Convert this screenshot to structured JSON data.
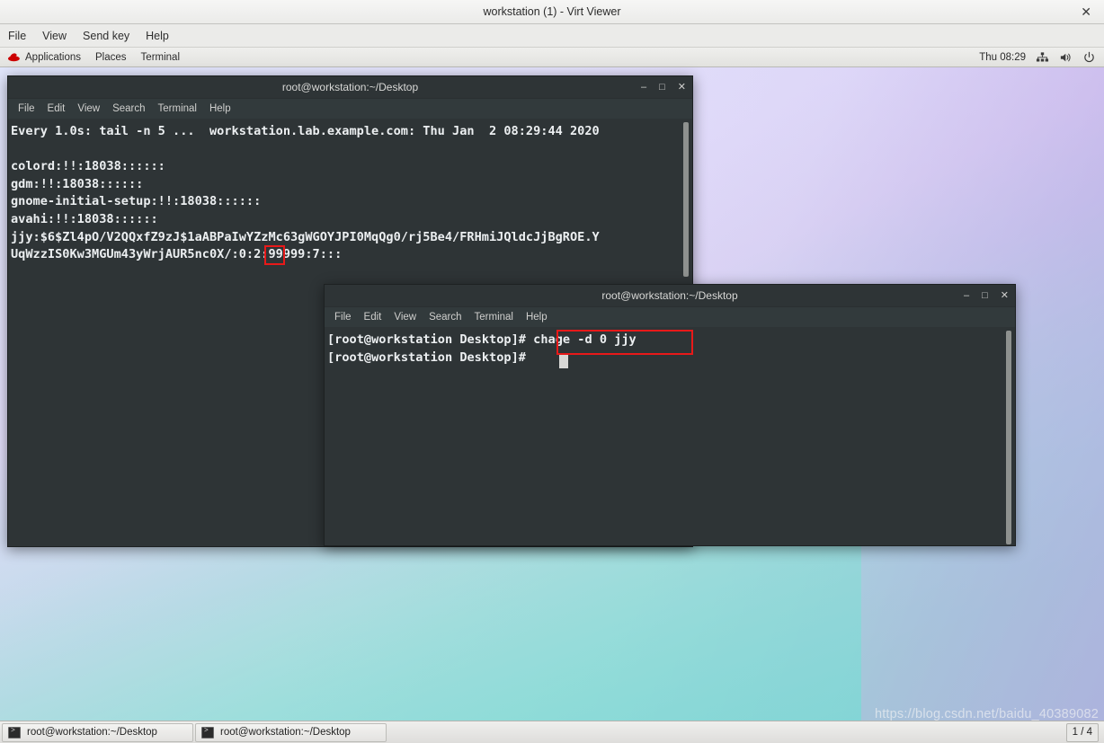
{
  "virt_viewer": {
    "title": "workstation (1) - Virt Viewer",
    "close_label": "✕",
    "menu": [
      "File",
      "View",
      "Send key",
      "Help"
    ]
  },
  "gnome_panel": {
    "applications": "Applications",
    "places": "Places",
    "terminal": "Terminal",
    "clock": "Thu 08:29",
    "icons": [
      "network-icon",
      "volume-icon",
      "power-icon"
    ]
  },
  "terminal_1": {
    "title": "root@workstation:~/Desktop",
    "menu": [
      "File",
      "Edit",
      "View",
      "Search",
      "Terminal",
      "Help"
    ],
    "window_buttons": {
      "minimize": "–",
      "maximize": "□",
      "close": "✕"
    },
    "content": "Every 1.0s: tail -n 5 ...  workstation.lab.example.com: Thu Jan  2 08:29:44 2020\n\ncolord:!!:18038::::::\ngdm:!!:18038::::::\ngnome-initial-setup:!!:18038::::::\navahi:!!:18038::::::\njjy:$6$Zl4pO/V2QQxfZ9zJ$1aABPaIwYZzMc63gWGOYJPI0MqQg0/rj5Be4/FRHmiJQldcJjBgROE.Y\nUqWzzIS0Kw3MGUm43yWrjAUR5nc0X/:0:2:99999:7:::"
  },
  "terminal_2": {
    "title": "root@workstation:~/Desktop",
    "menu": [
      "File",
      "Edit",
      "View",
      "Search",
      "Terminal",
      "Help"
    ],
    "window_buttons": {
      "minimize": "–",
      "maximize": "□",
      "close": "✕"
    },
    "prompt": "[root@workstation Desktop]# ",
    "command": "chage -d 0 jjy",
    "content": "[root@workstation Desktop]# chage -d 0 jjy\n[root@workstation Desktop]# "
  },
  "taskbar": {
    "items": [
      {
        "label": "root@workstation:~/Desktop",
        "icon": "terminal-icon"
      },
      {
        "label": "root@workstation:~/Desktop",
        "icon": "terminal-icon"
      }
    ],
    "workspace": "1 / 4"
  },
  "annotations": {
    "highlight_last_change_field": "0",
    "highlight_command": "chage -d 0 jjy"
  },
  "watermark": "https://blog.csdn.net/baidu_40389082",
  "colors": {
    "accent_red": "#e81919",
    "terminal_bg": "#2e3436",
    "terminal_fg": "#eceff1",
    "panel_bg": "#e9e9e7"
  }
}
